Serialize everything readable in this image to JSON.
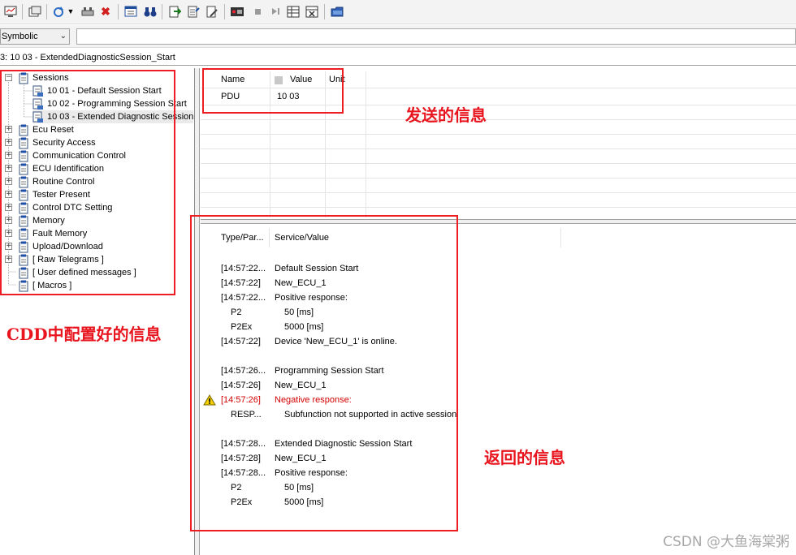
{
  "toolbar": {
    "icons": [
      "monitor-icon",
      "window-icon",
      "refresh-dropdown-icon",
      "connect-icon",
      "close-icon",
      "message-icon",
      "binoculars-icon",
      "export-icon",
      "import-icon",
      "edit-icon",
      "record-icon",
      "stop-icon",
      "skip-icon",
      "table-icon",
      "table-close-icon",
      "folder-icon"
    ]
  },
  "address_bar": {
    "mode_select": "Symbolic",
    "command_value": ""
  },
  "status_line": "3: 10 03 - ExtendedDiagnosticSession_Start",
  "tree": {
    "items": [
      {
        "label": "Sessions",
        "expander": "−"
      },
      {
        "label": "10 01 - Default Session Start"
      },
      {
        "label": "10 02 - Programming Session Start"
      },
      {
        "label": "10 03 - Extended Diagnostic Session"
      },
      {
        "label": "Ecu Reset",
        "expander": "+"
      },
      {
        "label": "Security Access",
        "expander": "+"
      },
      {
        "label": "Communication Control",
        "expander": "+"
      },
      {
        "label": "ECU Identification",
        "expander": "+"
      },
      {
        "label": "Routine Control",
        "expander": "+"
      },
      {
        "label": "Tester Present",
        "expander": "+"
      },
      {
        "label": "Control DTC Setting",
        "expander": "+"
      },
      {
        "label": "Memory",
        "expander": "+"
      },
      {
        "label": "Fault Memory",
        "expander": "+"
      },
      {
        "label": "Upload/Download",
        "expander": "+"
      },
      {
        "label": "[ Raw Telegrams ]",
        "expander": "+"
      },
      {
        "label": "[ User defined messages ]"
      },
      {
        "label": "[ Macros ]"
      }
    ]
  },
  "param_grid": {
    "headers": [
      "Name",
      "Value",
      "Unit"
    ],
    "rows": [
      {
        "name": "PDU",
        "value": "10 03",
        "unit": ""
      }
    ]
  },
  "log": {
    "headers": [
      "Type/Par...",
      "Service/Value"
    ],
    "rows": [
      {
        "a": "[14:57:22...",
        "b": "Default Session Start"
      },
      {
        "a": "[14:57:22]",
        "b": "New_ECU_1"
      },
      {
        "a": "[14:57:22...",
        "b": "Positive response:"
      },
      {
        "a": "P2",
        "b": "50 [ms]"
      },
      {
        "a": "P2Ex",
        "b": "5000 [ms]"
      },
      {
        "a": "[14:57:22]",
        "b": "Device 'New_ECU_1' is online."
      },
      {
        "a": "[14:57:26...",
        "b": "Programming Session Start"
      },
      {
        "a": "[14:57:26]",
        "b": "New_ECU_1"
      },
      {
        "a": "[14:57:26]",
        "b": "Negative response:"
      },
      {
        "a": "RESP...",
        "b": "Subfunction not supported in active session"
      },
      {
        "a": "[14:57:28...",
        "b": "Extended Diagnostic Session Start"
      },
      {
        "a": "[14:57:28]",
        "b": "New_ECU_1"
      },
      {
        "a": "[14:57:28...",
        "b": "Positive response:"
      },
      {
        "a": "P2",
        "b": "50 [ms]"
      },
      {
        "a": "P2Ex",
        "b": "5000 [ms]"
      }
    ]
  },
  "annotations": {
    "sent": "发送的信息",
    "cdd": "CDD中配置好的信息",
    "returned": "返回的信息"
  },
  "watermark": "CSDN @大鱼海棠粥",
  "colors": {
    "annotation_red": "#ee1c24",
    "negative_text": "#d40000",
    "warning_yellow": "#f5d000"
  }
}
